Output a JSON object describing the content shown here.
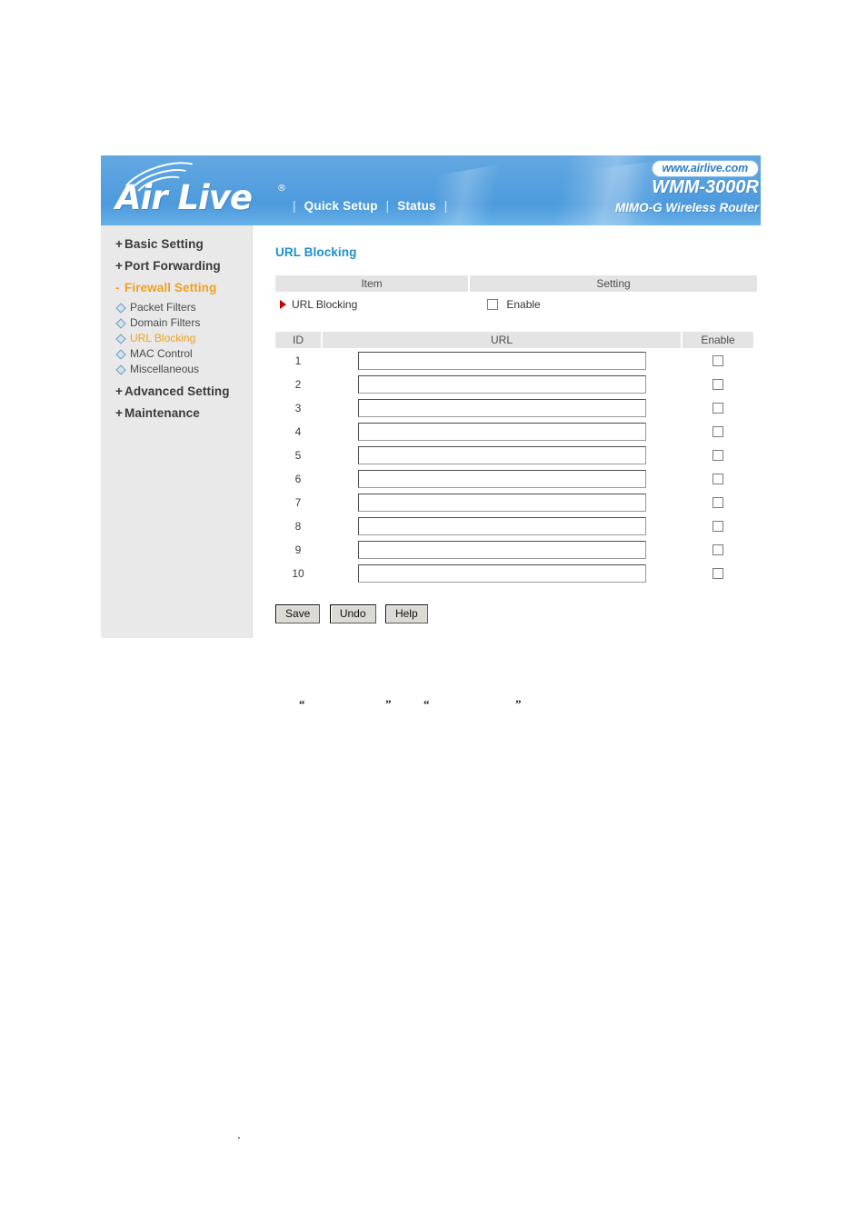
{
  "banner": {
    "logo_text": "Air Live",
    "logo_registered": "®",
    "nav": {
      "sep": "|",
      "quick_setup": "Quick Setup",
      "status": "Status"
    },
    "url_badge": "www.airlive.com",
    "model": "WMM-3000R",
    "subtitle": "MIMO-G Wireless Router"
  },
  "sidebar": {
    "items": [
      {
        "label": "Basic Setting",
        "marker": "+",
        "active": false
      },
      {
        "label": "Port Forwarding",
        "marker": "+",
        "active": false
      },
      {
        "label": "Firewall Setting",
        "marker": "-",
        "active": true
      },
      {
        "label": "Advanced Setting",
        "marker": "+",
        "active": false
      },
      {
        "label": "Maintenance",
        "marker": "+",
        "active": false
      }
    ],
    "subitems": [
      {
        "label": "Packet Filters",
        "active": false
      },
      {
        "label": "Domain Filters",
        "active": false
      },
      {
        "label": "URL Blocking",
        "active": true
      },
      {
        "label": "MAC Control",
        "active": false
      },
      {
        "label": "Miscellaneous",
        "active": false
      }
    ]
  },
  "content": {
    "page_title": "URL Blocking",
    "setting_table": {
      "headers": {
        "item": "Item",
        "setting": "Setting"
      },
      "row": {
        "item_label": "URL Blocking",
        "enable_label": "Enable",
        "enable_checked": false
      }
    },
    "url_table": {
      "headers": {
        "id": "ID",
        "url": "URL",
        "enable": "Enable"
      },
      "rows": [
        {
          "id": "1",
          "url": "",
          "enabled": false
        },
        {
          "id": "2",
          "url": "",
          "enabled": false
        },
        {
          "id": "3",
          "url": "",
          "enabled": false
        },
        {
          "id": "4",
          "url": "",
          "enabled": false
        },
        {
          "id": "5",
          "url": "",
          "enabled": false
        },
        {
          "id": "6",
          "url": "",
          "enabled": false
        },
        {
          "id": "7",
          "url": "",
          "enabled": false
        },
        {
          "id": "8",
          "url": "",
          "enabled": false
        },
        {
          "id": "9",
          "url": "",
          "enabled": false
        },
        {
          "id": "10",
          "url": "",
          "enabled": false
        }
      ]
    },
    "buttons": {
      "save": "Save",
      "undo": "Undo",
      "help": "Help"
    }
  },
  "annotations": {
    "quote_open_1": "“",
    "quote_close_1": "”",
    "quote_open_2": "“",
    "quote_close_2": "”",
    "tail_mark": "’"
  },
  "colors": {
    "banner_blue": "#56a0de",
    "title_blue": "#1b8ed0",
    "accent_orange": "#f0a01e",
    "arrow_red": "#cc0000",
    "sidebar_gray": "#e9e9e9",
    "header_gray": "#e4e4e4"
  }
}
